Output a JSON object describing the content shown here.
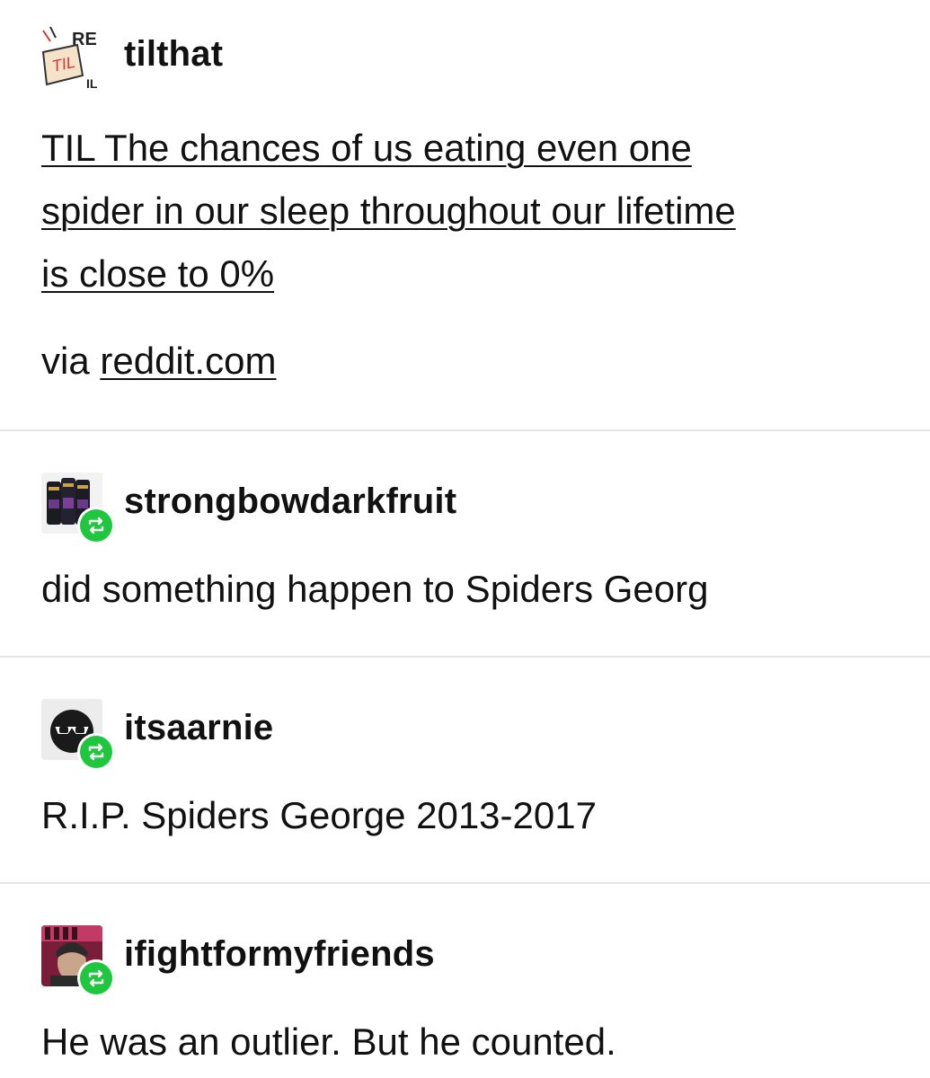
{
  "posts": [
    {
      "username": "tilthat",
      "avatar_icon": "til-logo-icon",
      "avatar_text": {
        "top": "RE",
        "badge": "TIL",
        "bottom": "IL"
      },
      "link_lines": [
        "TIL The chances of us eating even one",
        "spider in our sleep throughout our lifetime",
        "is close to 0%"
      ],
      "via_prefix": "via",
      "via_link": "reddit.com"
    },
    {
      "username": "strongbowdarkfruit",
      "avatar_icon": "cans-avatar-icon",
      "badge_icon": "reblog-icon",
      "text": "did something happen to Spiders Georg"
    },
    {
      "username": "itsaarnie",
      "avatar_icon": "sunglasses-avatar-icon",
      "badge_icon": "reblog-icon",
      "text": "R.I.P. Spiders George 2013-2017"
    },
    {
      "username": "ifightformyfriends",
      "avatar_icon": "character-avatar-icon",
      "badge_icon": "reblog-icon",
      "text": "He was an outlier. But he counted."
    }
  ],
  "colors": {
    "reblog_green": "#1fc73e",
    "divider": "#e6e6e6",
    "text": "#111111"
  }
}
